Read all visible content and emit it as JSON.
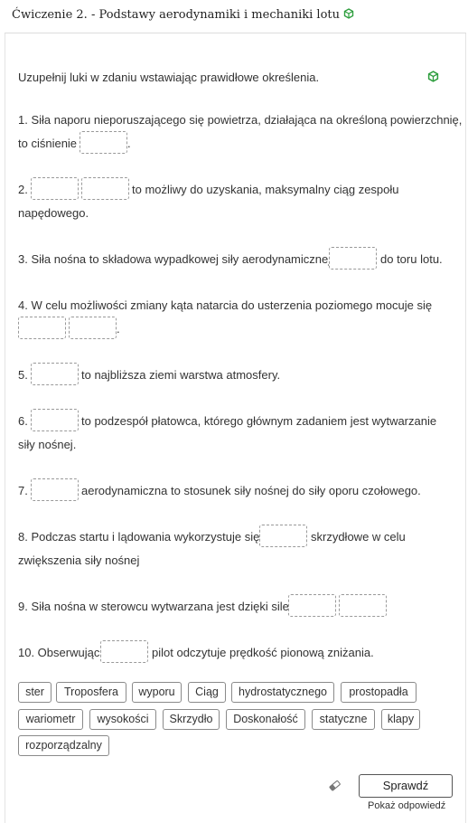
{
  "header": {
    "title": "Ćwiczenie 2. - Podstawy aerodynamiki i mechaniki lotu"
  },
  "instruction": "Uzupełnij luki w zdaniu wstawiając prawidłowe określenia.",
  "questions": {
    "q1": {
      "line1": "1. Siła naporu nieporuszającego się powietrza, działająca na określoną powierzchnię,",
      "line2a": "to ciśnienie",
      "line2b": "."
    },
    "q2": {
      "a": "2.",
      "b": "to możliwy do uzyskania, maksymalny ciąg zespołu",
      "c": "napędowego."
    },
    "q3": {
      "a": "3. Siła nośna to składowa wypadkowej siły aerodynamicznej",
      "b": "do toru lotu."
    },
    "q4": {
      "a": "4. W celu możliwości zmiany kąta natarcia do usterzenia poziomego mocuje się",
      "b": "."
    },
    "q5": {
      "a": "5.",
      "b": "to najbliższa ziemi warstwa atmosfery."
    },
    "q6": {
      "a": "6.",
      "b": "to podzespół płatowca, którego głównym zadaniem jest wytwarzanie",
      "c": "siły nośnej."
    },
    "q7": {
      "a": "7.",
      "b": "aerodynamiczna to stosunek siły nośnej do siły oporu czołowego."
    },
    "q8": {
      "a": "8. Podczas startu i lądowania wykorzystuje się",
      "b": "skrzydłowe w celu",
      "c": "zwiększenia siły nośnej"
    },
    "q9": {
      "a": "9. Siła nośna w sterowcu wytwarzana jest dzięki sile"
    },
    "q10": {
      "a": "10. Obserwując",
      "b": "pilot odczytuje prędkość pionową zniżania."
    }
  },
  "word_bank": [
    "ster",
    "Troposfera",
    "wyporu",
    "Ciąg",
    "hydrostatycznego",
    "prostopadła",
    "wariometr",
    "wysokości",
    "Skrzydło",
    "Doskonałość",
    "statyczne",
    "klapy",
    "rozporządzalny"
  ],
  "actions": {
    "check_label": "Sprawdź",
    "show_answer_label": "Pokaż odpowiedź"
  },
  "colors": {
    "accent_green": "#2e9e3e",
    "gap_border": "#9a9a9a",
    "chip_border": "#8a8a8a"
  },
  "icons": {
    "header_icon": "cube-icon",
    "instruction_icon": "cube-icon",
    "reset_icon": "eraser-icon"
  }
}
